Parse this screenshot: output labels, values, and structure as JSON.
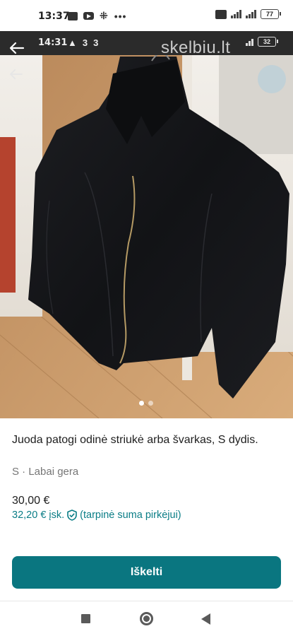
{
  "status_bar": {
    "time": "13:37",
    "battery": "77"
  },
  "embedded_status_bar": {
    "time": "14:31",
    "battery": "32"
  },
  "watermark": "skelbiu.lt",
  "listing": {
    "title": "Juoda patogi odinė striukė  arba švarkas, S dydis.",
    "meta": "S · Labai gera",
    "price": "30,00 €",
    "price_incl": "32,20 € įsk.",
    "price_incl_note": "(tarpinė suma pirkėjui)",
    "image_count": 2,
    "active_image": 1
  },
  "actions": {
    "buy_label": "Iškelti"
  },
  "colors": {
    "accent": "#0a7680",
    "accent_text": "#0a7d86",
    "muted": "#767676"
  },
  "icons": {
    "back": "arrow-left-icon",
    "protection": "shield-check-icon",
    "nav_recent": "square-icon",
    "nav_home": "circle-icon",
    "nav_back": "triangle-back-icon"
  }
}
